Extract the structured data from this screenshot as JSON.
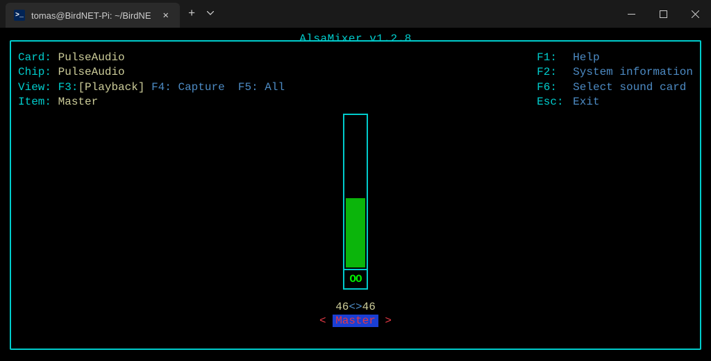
{
  "window": {
    "tab_title": "tomas@BirdNET-Pi: ~/BirdNE"
  },
  "app": {
    "title": "AlsaMixer v1.2.8",
    "info": {
      "card_label": "Card:",
      "card_value": "PulseAudio",
      "chip_label": "Chip:",
      "chip_value": "PulseAudio",
      "view_label": "View:",
      "view_f3": "F3:",
      "view_f3_val": "[Playback]",
      "view_f4": "F4: Capture",
      "view_f5": "F5: All",
      "item_label": "Item:",
      "item_value": "Master"
    },
    "help": {
      "f1_key": "F1:",
      "f1_desc": "Help",
      "f2_key": "F2:",
      "f2_desc": "System information",
      "f6_key": "F6:",
      "f6_desc": "Select sound card",
      "esc_key": "Esc:",
      "esc_desc": "Exit"
    },
    "mixer": {
      "mute_indicator": "OO",
      "level_left": "46",
      "level_sep": "<>",
      "level_right": "46",
      "bracket_l": "< ",
      "channel_name": "Master",
      "bracket_r": " >",
      "fill_percent": 46
    }
  }
}
